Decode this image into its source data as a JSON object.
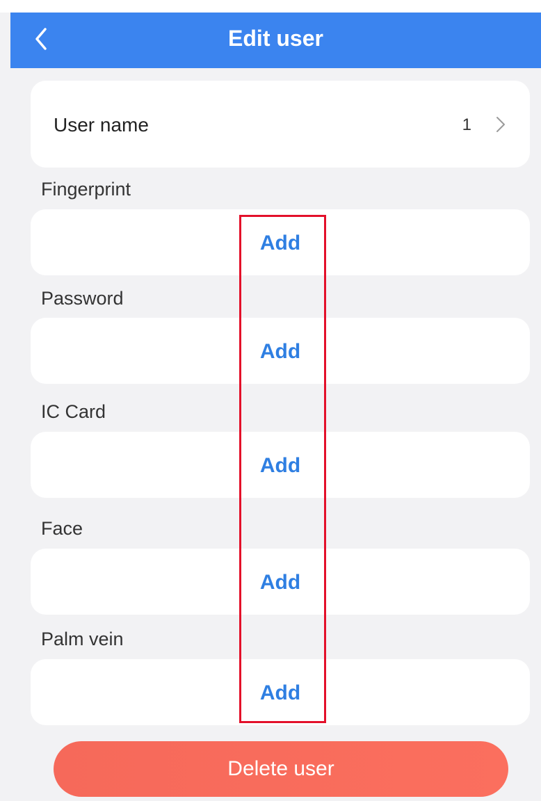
{
  "header": {
    "title": "Edit user",
    "back_icon": "chevron-left-icon"
  },
  "user_name": {
    "label": "User name",
    "value": "1",
    "chevron_icon": "chevron-right-icon"
  },
  "sections": [
    {
      "label": "Fingerprint",
      "action": "Add"
    },
    {
      "label": "Password",
      "action": "Add"
    },
    {
      "label": "IC Card",
      "action": "Add"
    },
    {
      "label": "Face",
      "action": "Add"
    },
    {
      "label": "Palm vein",
      "action": "Add"
    }
  ],
  "delete_button": {
    "label": "Delete user"
  },
  "colors": {
    "header_bg": "#3b84ef",
    "add_text": "#2f7fe2",
    "delete_bg": "#f6695a",
    "highlight": "#e3102a"
  }
}
